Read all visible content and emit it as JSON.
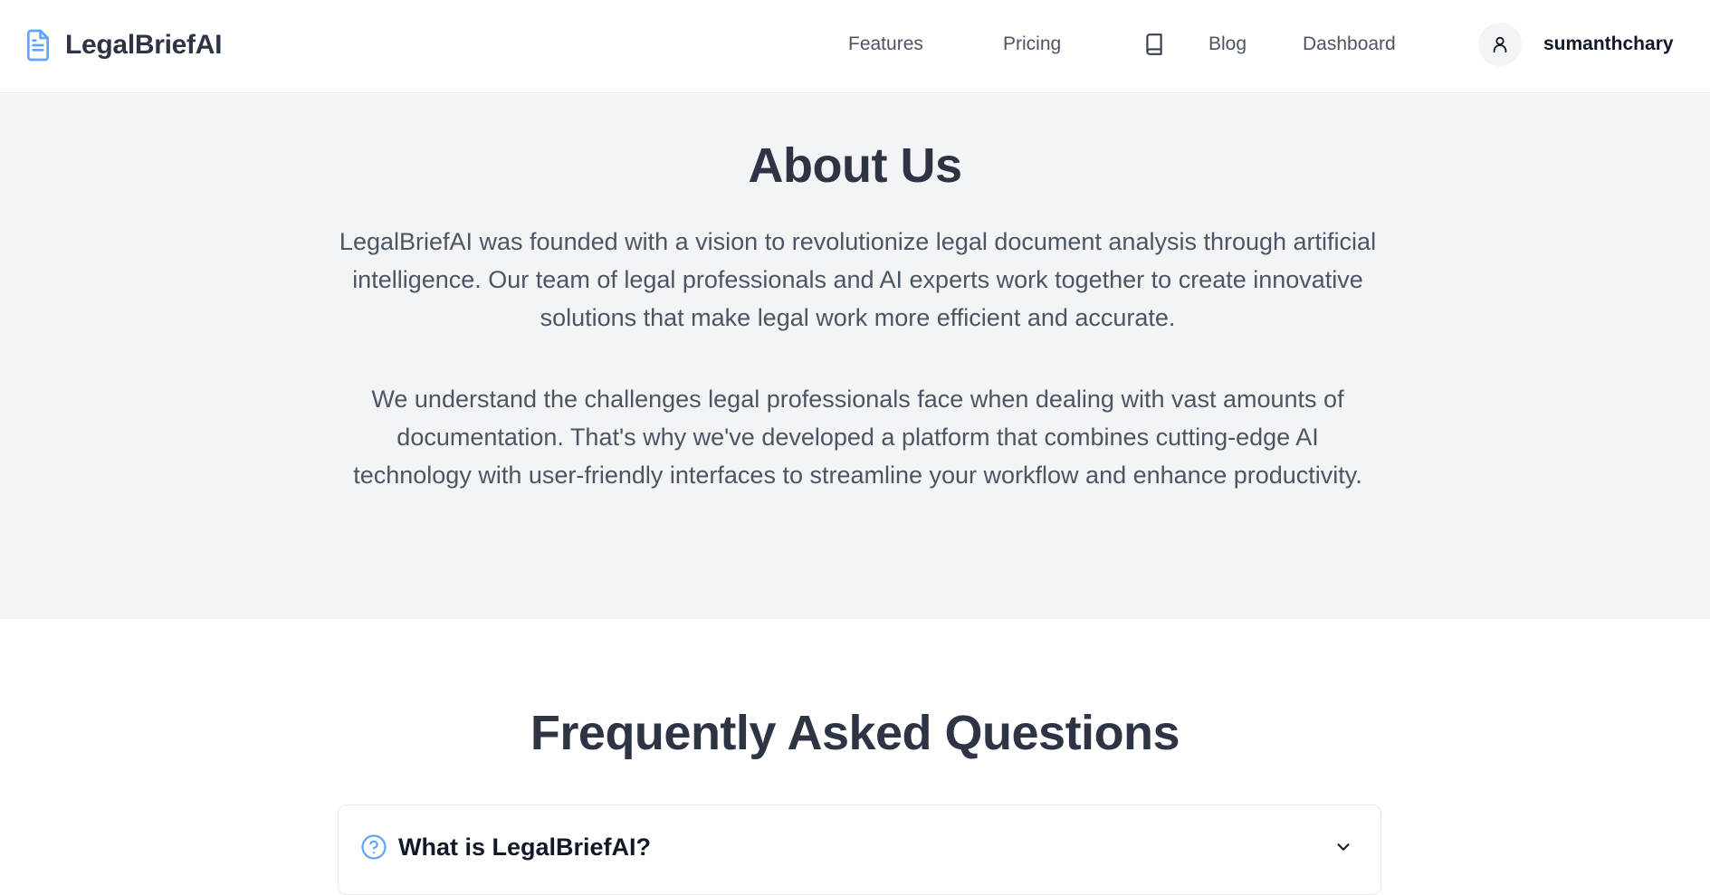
{
  "nav": {
    "brand": "LegalBriefAI",
    "brand_icon": "document-icon",
    "links": {
      "features": "Features",
      "pricing": "Pricing",
      "blog": "Blog",
      "blog_icon": "book-icon",
      "dashboard": "Dashboard"
    },
    "user": {
      "avatar_icon": "user-icon",
      "name": "sumanthchary"
    }
  },
  "about": {
    "title": "About Us",
    "paragraphs": [
      "LegalBriefAI was founded with a vision to revolutionize legal document analysis through artificial intelligence. Our team of legal professionals and AI experts work together to create innovative solutions that make legal work more efficient and accurate.",
      "We understand the challenges legal professionals face when dealing with vast amounts of documentation. That's why we've developed a platform that combines cutting-edge AI technology with user-friendly interfaces to streamline your workflow and enhance productivity."
    ]
  },
  "faq": {
    "title": "Frequently Asked Questions",
    "items": [
      {
        "icon": "help-circle-icon",
        "question": "What is LegalBriefAI?",
        "expanded": false,
        "toggle_icon": "chevron-down-icon"
      }
    ]
  },
  "colors": {
    "brand_icon": "#60a5fa",
    "heading": "#2d3443",
    "body_text": "#4b5563",
    "section_bg": "#f3f4f6",
    "border": "#e5e7eb"
  }
}
